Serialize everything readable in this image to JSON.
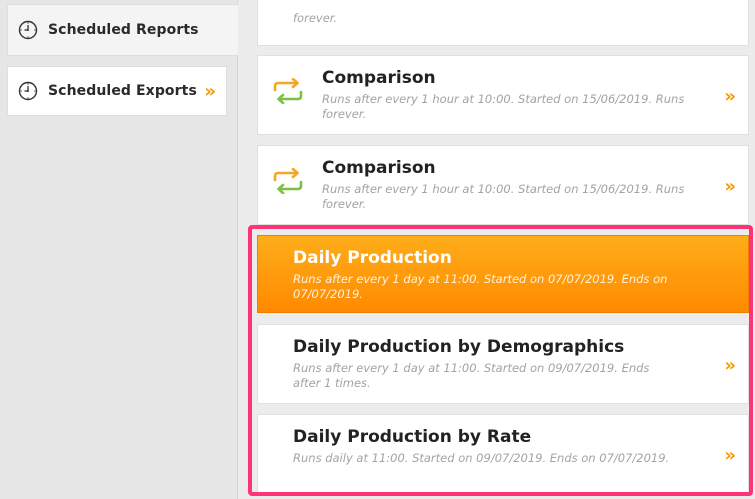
{
  "sidebar": {
    "items": [
      {
        "label": "Scheduled Reports",
        "icon": "clock-icon",
        "active": true
      },
      {
        "label": "Scheduled Exports",
        "icon": "clock-icon",
        "chevron": "»"
      }
    ]
  },
  "reports": {
    "top_partial": {
      "desc": "forever."
    },
    "items": [
      {
        "title": "Comparison",
        "desc": "Runs after every 1 hour at 10:00. Started on 15/06/2019. Runs forever.",
        "chevron": "»",
        "icon": "repeat-icon"
      },
      {
        "title": "Comparison",
        "desc": "Runs after every 1 hour at 10:00. Started on 15/06/2019. Runs forever.",
        "chevron": "»",
        "icon": "repeat-icon"
      },
      {
        "title": "Daily Production",
        "desc": "Runs after every 1 day at 11:00. Started on 07/07/2019. Ends on 07/07/2019.",
        "selected": true
      },
      {
        "title": "Daily Production by Demographics",
        "desc": "Runs after every 1 day at 11:00. Started on 09/07/2019. Ends after 1 times.",
        "chevron": "»"
      },
      {
        "title": "Daily Production by Rate",
        "desc": "Runs daily at 11:00. Started on 09/07/2019. Ends on 07/07/2019.",
        "chevron": "»"
      }
    ]
  },
  "colors": {
    "accent": "#f29a00",
    "selected_start": "#ffad1a",
    "selected_end": "#ff8a00",
    "highlight": "#ff3377",
    "repeat_orange": "#f5a623",
    "repeat_green": "#7cc142"
  }
}
